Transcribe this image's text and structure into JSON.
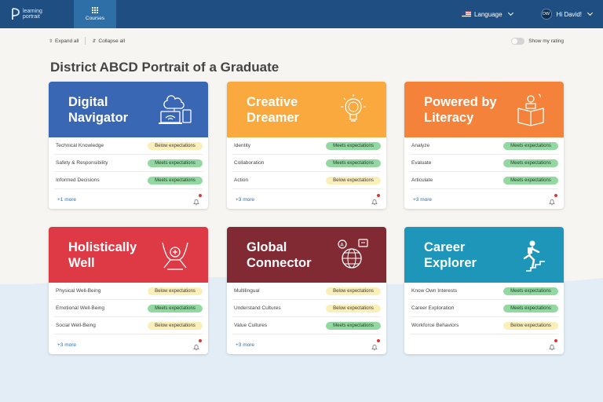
{
  "header": {
    "logo_text_line1": "learning",
    "logo_text_line2": "portrait",
    "courses_label": "Courses",
    "language_label": "Language",
    "user_initials": "DW",
    "greeting": "Hi David!"
  },
  "toolbar": {
    "expand_all": "Expand all",
    "collapse_all": "Collapse all",
    "show_rating": "Show my rating"
  },
  "page_title": "District ABCD Portrait of a Graduate",
  "cards": [
    {
      "title_line1": "Digital",
      "title_line2": "Navigator",
      "color": "#3a67b3",
      "icon": "devices-icon",
      "rows": [
        {
          "label": "Technical Knowledge",
          "status": "Below expectations"
        },
        {
          "label": "Safety & Responsibility",
          "status": "Meets expectations"
        },
        {
          "label": "Informed Decisions",
          "status": "Meets expectations"
        }
      ],
      "more": "+1 more"
    },
    {
      "title_line1": "Creative",
      "title_line2": "Dreamer",
      "color": "#f9a93e",
      "icon": "lightbulb-icon",
      "rows": [
        {
          "label": "Identity",
          "status": "Meets expectations"
        },
        {
          "label": "Collaboration",
          "status": "Meets expectations"
        },
        {
          "label": "Action",
          "status": "Below expectations"
        }
      ],
      "more": "+3 more"
    },
    {
      "title_line1": "Powered by",
      "title_line2": "Literacy",
      "color": "#f5823a",
      "icon": "reader-icon",
      "rows": [
        {
          "label": "Analyze",
          "status": "Meets expectations"
        },
        {
          "label": "Evaluate",
          "status": "Meets expectations"
        },
        {
          "label": "Articulate",
          "status": "Meets expectations"
        }
      ],
      "more": "+3 more"
    },
    {
      "title_line1": "Holistically",
      "title_line2": "Well",
      "color": "#de3a45",
      "icon": "hands-icon",
      "rows": [
        {
          "label": "Physical Well-Being",
          "status": "Below expectations"
        },
        {
          "label": "Emotional Well-Being",
          "status": "Meets expectations"
        },
        {
          "label": "Social Well-Being",
          "status": "Below expectations"
        }
      ],
      "more": "+3 more"
    },
    {
      "title_line1": "Global",
      "title_line2": "Connector",
      "color": "#822a33",
      "icon": "globe-icon",
      "rows": [
        {
          "label": "Multilingual",
          "status": "Below expectations"
        },
        {
          "label": "Understand Cultures",
          "status": "Below expectations"
        },
        {
          "label": "Value Cultures",
          "status": "Meets expectations"
        }
      ],
      "more": "+3 more"
    },
    {
      "title_line1": "Career",
      "title_line2": "Explorer",
      "color": "#1e96b9",
      "icon": "climber-icon",
      "rows": [
        {
          "label": "Know Own Interests",
          "status": "Meets expectations"
        },
        {
          "label": "Career Exploration",
          "status": "Meets expectations"
        },
        {
          "label": "Workforce Behaviors",
          "status": "Below expectations"
        }
      ],
      "more": ""
    }
  ]
}
